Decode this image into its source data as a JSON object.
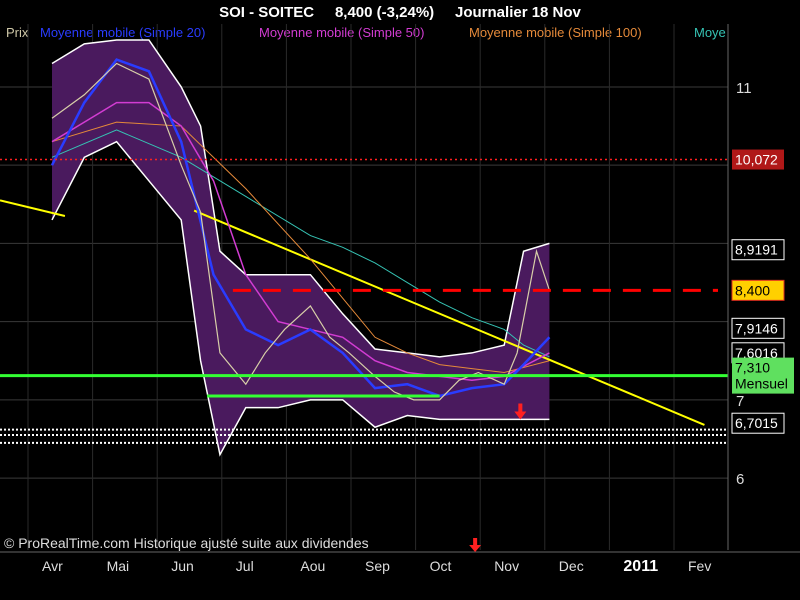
{
  "header": {
    "symbol": "SOI - SOITEC",
    "price": "8,400 (-3,24%)",
    "period": "Journalier 18 Nov"
  },
  "legend": {
    "prefix": "Prix",
    "items": [
      {
        "label": "Moyenne mobile (Simple 20)",
        "color": "#2a3cff"
      },
      {
        "label": "Moyenne mobile (Simple 50)",
        "color": "#d23cd2"
      },
      {
        "label": "Moyenne mobile (Simple 100)",
        "color": "#e58a3a"
      },
      {
        "label": "Moye",
        "color": "#36c3b4"
      }
    ]
  },
  "credit": "© ProRealTime.com Historique ajusté suite aux dividendes",
  "colors": {
    "background": "#000000",
    "band_fill": "#4a1a5e",
    "band_edge": "#ffffff",
    "price": "#d8cfa8",
    "trendline": "#ffff00",
    "support": "#33ff33",
    "resistance": "#ff0000",
    "level": "#ff2020"
  },
  "chart_data": {
    "type": "line",
    "x_ticks": [
      "Avr",
      "Mai",
      "Jun",
      "Jul",
      "Aou",
      "Sep",
      "Oct",
      "Nov",
      "Dec",
      "2011",
      "Fev"
    ],
    "y_ticks": [
      "6",
      "7",
      "11"
    ],
    "ylim": [
      5.95,
      11.6
    ],
    "series": [
      {
        "name": "Prix",
        "x": [
          0,
          0.5,
          1,
          1.5,
          2,
          2.3,
          2.6,
          3,
          3.3,
          3.6,
          4,
          4.3,
          4.6,
          5,
          5.3,
          5.6,
          6,
          6.3,
          6.6,
          7,
          7.2,
          7.5,
          7.7
        ],
        "values": [
          10.6,
          10.9,
          11.3,
          11.1,
          10.0,
          9.4,
          7.6,
          7.2,
          7.6,
          7.9,
          8.2,
          7.8,
          7.6,
          7.3,
          7.1,
          7.0,
          7.0,
          7.25,
          7.35,
          7.2,
          7.6,
          8.9,
          8.4
        ]
      },
      {
        "name": "Moyenne mobile (Simple 20)",
        "x": [
          0,
          0.5,
          1,
          1.5,
          2,
          2.5,
          3,
          3.5,
          4,
          4.5,
          5,
          5.5,
          6,
          6.5,
          7,
          7.3,
          7.7
        ],
        "values": [
          10.0,
          10.8,
          11.35,
          11.2,
          10.3,
          8.6,
          7.9,
          7.7,
          7.9,
          7.6,
          7.15,
          7.2,
          7.05,
          7.15,
          7.2,
          7.45,
          7.8
        ]
      },
      {
        "name": "Moyenne mobile (Simple 50)",
        "x": [
          0,
          1,
          1.5,
          2,
          2.5,
          3,
          3.5,
          4,
          4.5,
          5,
          5.5,
          6,
          6.5,
          7,
          7.7
        ],
        "values": [
          10.3,
          10.8,
          10.8,
          10.5,
          9.8,
          8.6,
          8.0,
          7.9,
          7.8,
          7.5,
          7.35,
          7.3,
          7.25,
          7.3,
          7.6
        ]
      },
      {
        "name": "Moyenne mobile (Simple 100)",
        "x": [
          0,
          1,
          2,
          3,
          4,
          4.5,
          5,
          5.5,
          6,
          6.5,
          7,
          7.7
        ],
        "values": [
          10.3,
          10.55,
          10.5,
          9.7,
          8.8,
          8.3,
          7.8,
          7.6,
          7.45,
          7.4,
          7.35,
          7.5
        ]
      },
      {
        "name": "Moye",
        "x": [
          0,
          1,
          2,
          3,
          4,
          4.5,
          5,
          5.5,
          6,
          6.5,
          7,
          7.3,
          7.7
        ],
        "values": [
          10.1,
          10.45,
          10.1,
          9.6,
          9.1,
          8.95,
          8.75,
          8.5,
          8.25,
          8.05,
          7.9,
          7.7,
          7.55
        ]
      }
    ],
    "bollinger": {
      "x": [
        0,
        0.5,
        1,
        1.5,
        2,
        2.3,
        2.6,
        3,
        3.5,
        4,
        4.5,
        5,
        5.5,
        6,
        6.5,
        7,
        7.3,
        7.7
      ],
      "upper": [
        11.3,
        11.55,
        11.6,
        11.6,
        11.0,
        10.5,
        8.9,
        8.6,
        8.6,
        8.6,
        8.1,
        7.65,
        7.6,
        7.55,
        7.6,
        7.7,
        8.9,
        9.0
      ],
      "lower": [
        9.3,
        10.1,
        10.3,
        9.8,
        9.3,
        7.5,
        6.3,
        6.9,
        6.9,
        7.0,
        7.0,
        6.65,
        6.8,
        6.75,
        6.75,
        6.75,
        6.75,
        6.75
      ]
    },
    "trendline": {
      "x": [
        2.2,
        10.1
      ],
      "values": [
        9.42,
        6.68
      ]
    },
    "levels": [
      {
        "value": 10.072,
        "label": "10,072",
        "style": "dotted-red"
      },
      {
        "value": 8.9191,
        "label": "8,9191"
      },
      {
        "value": 8.4,
        "label": "8,400",
        "style": "dashed-red"
      },
      {
        "value": 7.9146,
        "label": "7,9146"
      },
      {
        "value": 7.6016,
        "label": "7,6016"
      },
      {
        "value": 7.31,
        "label": "7,310",
        "sublabel": "Mensuel",
        "style": "green"
      },
      {
        "value": 6.7015,
        "label": "6,7015"
      }
    ],
    "support_short": {
      "x": [
        2.4,
        6.0
      ],
      "value": 7.05
    },
    "dotted_white": [
      6.62,
      6.55,
      6.45
    ],
    "red_arrows": [
      {
        "x": 7.25,
        "value": 6.8
      }
    ],
    "axis_arrow": {
      "x": 6.55
    }
  }
}
